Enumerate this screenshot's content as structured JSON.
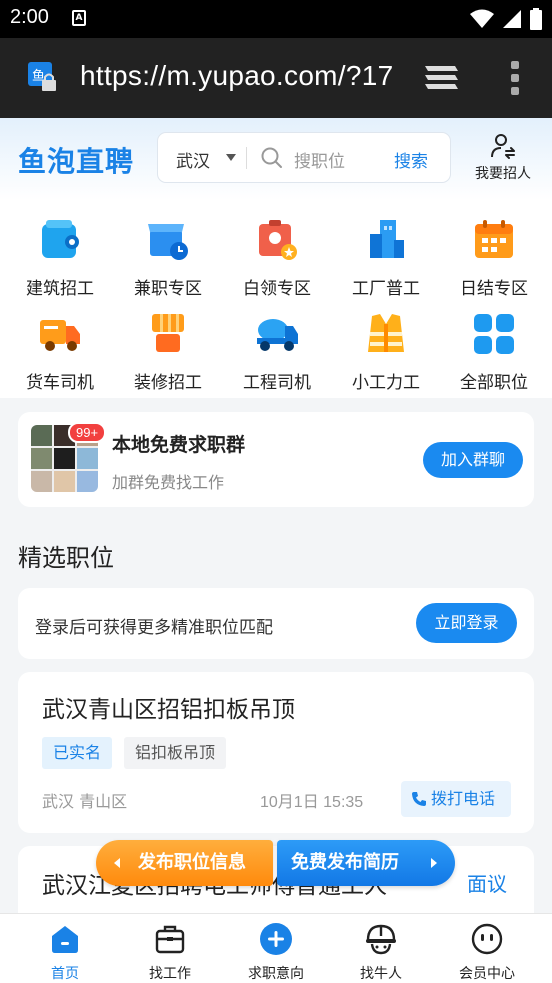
{
  "status_bar": {
    "time": "2:00",
    "notification": "A"
  },
  "browser": {
    "url": "https://m.yupao.com/?17"
  },
  "header": {
    "logo": "鱼泡直聘",
    "city": "武汉",
    "search_placeholder": "搜职位",
    "search_button": "搜索",
    "recruit_label": "我要招人"
  },
  "categories": [
    {
      "label": "建筑招工",
      "icon": "helmet-icon"
    },
    {
      "label": "兼职专区",
      "icon": "store-clock-icon"
    },
    {
      "label": "白领专区",
      "icon": "id-badge-icon"
    },
    {
      "label": "工厂普工",
      "icon": "factory-icon"
    },
    {
      "label": "日结专区",
      "icon": "calendar-icon"
    },
    {
      "label": "货车司机",
      "icon": "truck-icon"
    },
    {
      "label": "装修招工",
      "icon": "paint-roller-icon"
    },
    {
      "label": "工程司机",
      "icon": "mixer-truck-icon"
    },
    {
      "label": "小工力工",
      "icon": "vest-icon"
    },
    {
      "label": "全部职位",
      "icon": "grid-icon"
    }
  ],
  "group_card": {
    "badge": "99+",
    "title": "本地免费求职群",
    "subtitle": "加群免费找工作",
    "button": "加入群聊"
  },
  "section_title": "精选职位",
  "login_prompt": {
    "text": "登录后可获得更多精准职位匹配",
    "button": "立即登录"
  },
  "jobs": [
    {
      "title": "武汉青山区招铝扣板吊顶",
      "tags": [
        "已实名",
        "铝扣板吊顶"
      ],
      "location": "武汉 青山区",
      "time": "10月1日 15:35",
      "call_button": "拨打电话"
    },
    {
      "title": "武汉江夏区招聘电工师傅普通工人",
      "salary": "面议"
    }
  ],
  "floating_buttons": {
    "post_job": "发布职位信息",
    "post_resume": "免费发布简历"
  },
  "tabbar": [
    {
      "label": "首页",
      "icon": "home-icon",
      "active": true
    },
    {
      "label": "找工作",
      "icon": "briefcase-icon",
      "active": false
    },
    {
      "label": "求职意向",
      "icon": "plus-circle-icon",
      "active": false
    },
    {
      "label": "找牛人",
      "icon": "worker-helmet-icon",
      "active": false
    },
    {
      "label": "会员中心",
      "icon": "smile-icon",
      "active": false
    }
  ],
  "colors": {
    "brand": "#1a82e6",
    "accent_orange": "#ff8a0c",
    "badge_red": "#f2403f"
  }
}
